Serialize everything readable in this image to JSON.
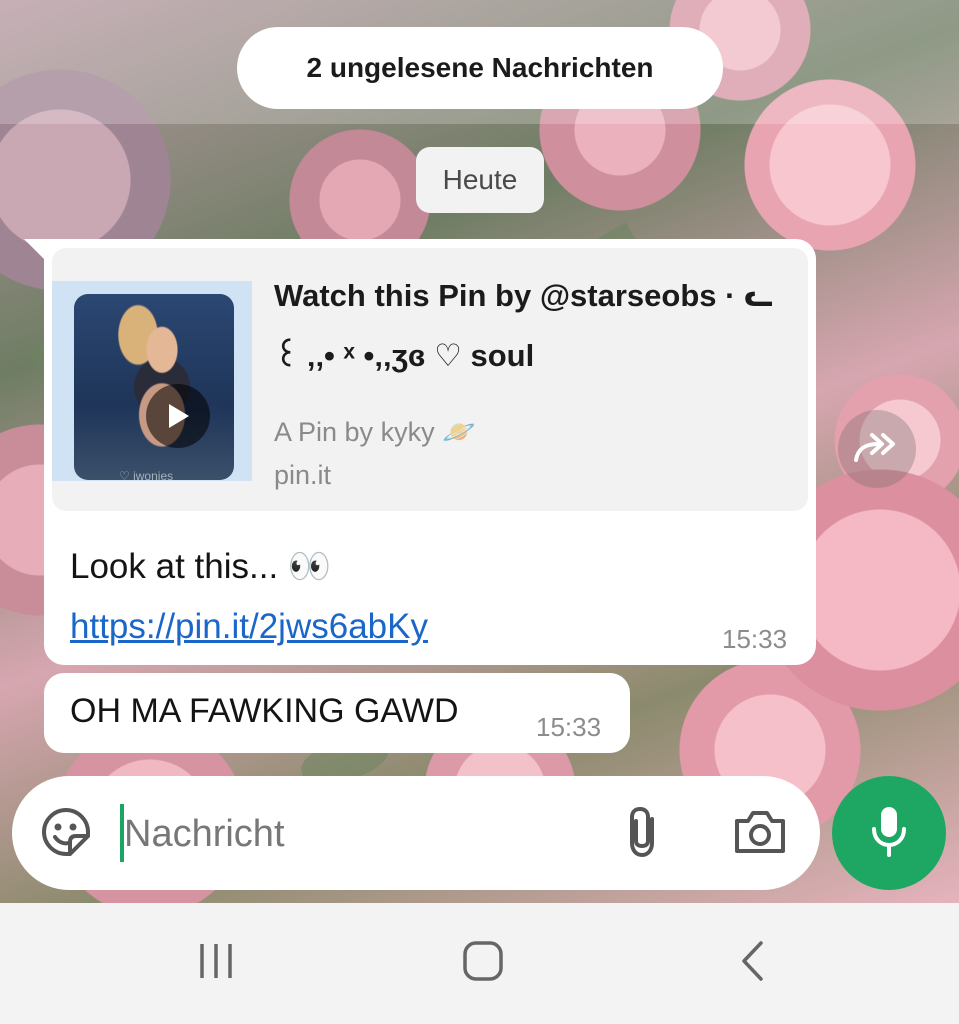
{
  "banner": {
    "unread_label": "2 ungelesene Nachrichten"
  },
  "date_chip": {
    "label": "Heute"
  },
  "messages": [
    {
      "link_preview": {
        "title": "Watch this Pin by @starseobs · ᓚ ꒰ ‚‚• ˣ •‚‚ʒɞ ♡ soul",
        "description": "A Pin by kyky 🪐",
        "domain": "pin.it",
        "thumbnail_watermark": "♡ jwonies"
      },
      "text_prefix": "Look at this... 👀 ",
      "link_text": "https://pin.it/2jws6abKy",
      "time": "15:33"
    },
    {
      "text": "OH MA FAWKING GAWD",
      "time": "15:33"
    }
  ],
  "composer": {
    "placeholder": "Nachricht",
    "value": ""
  },
  "icons": {
    "forward": "forward-icon",
    "sticker": "sticker-icon",
    "attach": "paperclip-icon",
    "camera": "camera-icon",
    "mic": "microphone-icon",
    "nav_recents": "recents-icon",
    "nav_home": "home-icon",
    "nav_back": "back-icon"
  },
  "colors": {
    "accent": "#1ea763",
    "link": "#1b67c9",
    "bubble": "#ffffff"
  }
}
